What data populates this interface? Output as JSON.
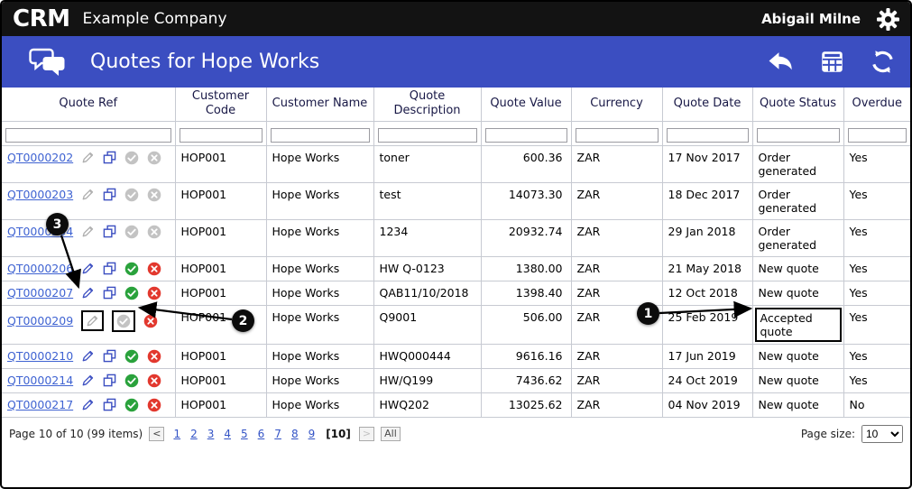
{
  "topbar": {
    "logo_text": "CRM",
    "company": "Example Company",
    "user": "Abigail Milne"
  },
  "header": {
    "title": "Quotes for Hope Works"
  },
  "colors": {
    "brand_blue": "#3b4ec1",
    "link_blue": "#3f63d2",
    "accept_green": "#2aa23c",
    "reject_red": "#e2382e",
    "disabled_grey": "#aeaeae",
    "disabled_circle_grey": "#c3c3c3"
  },
  "table": {
    "columns": [
      "Quote Ref",
      "Customer Code",
      "Customer Name",
      "Quote Description",
      "Quote Value",
      "Currency",
      "Quote Date",
      "Quote Status",
      "Overdue"
    ],
    "rows": [
      {
        "ref": "QT0000202",
        "icons": [
          "edit-disabled",
          "copy",
          "accept-disabled",
          "reject-disabled"
        ],
        "code": "HOP001",
        "name": "Hope Works",
        "desc": "toner",
        "value": "600.36",
        "currency": "ZAR",
        "date": "17 Nov 2017",
        "status": "Order generated",
        "overdue": "Yes",
        "status_boxed": false
      },
      {
        "ref": "QT0000203",
        "icons": [
          "edit-disabled",
          "copy",
          "accept-disabled",
          "reject-disabled"
        ],
        "code": "HOP001",
        "name": "Hope Works",
        "desc": "test",
        "value": "14073.30",
        "currency": "ZAR",
        "date": "18 Dec 2017",
        "status": "Order generated",
        "overdue": "Yes",
        "status_boxed": false
      },
      {
        "ref": "QT0000204",
        "icons": [
          "edit-disabled",
          "copy",
          "accept-disabled",
          "reject-disabled"
        ],
        "code": "HOP001",
        "name": "Hope Works",
        "desc": "1234",
        "value": "20932.74",
        "currency": "ZAR",
        "date": "29 Jan 2018",
        "status": "Order generated",
        "overdue": "Yes",
        "status_boxed": false
      },
      {
        "ref": "QT0000206",
        "icons": [
          "edit",
          "copy",
          "accept",
          "reject"
        ],
        "code": "HOP001",
        "name": "Hope Works",
        "desc": "HW Q-0123",
        "value": "1380.00",
        "currency": "ZAR",
        "date": "21 May 2018",
        "status": "New quote",
        "overdue": "Yes",
        "status_boxed": false
      },
      {
        "ref": "QT0000207",
        "icons": [
          "edit",
          "copy",
          "accept",
          "reject"
        ],
        "code": "HOP001",
        "name": "Hope Works",
        "desc": "QAB11/10/2018",
        "value": "1398.40",
        "currency": "ZAR",
        "date": "12 Oct 2018",
        "status": "New quote",
        "overdue": "Yes",
        "status_boxed": false
      },
      {
        "ref": "QT0000209",
        "icons": [
          "edit-disabled-boxed",
          "accept-disabled-boxed",
          "reject"
        ],
        "code": "HOP001",
        "name": "Hope Works",
        "desc": "Q9001",
        "value": "506.00",
        "currency": "ZAR",
        "date": "25 Feb 2019",
        "status": "Accepted quote",
        "overdue": "Yes",
        "status_boxed": true
      },
      {
        "ref": "QT0000210",
        "icons": [
          "edit",
          "copy",
          "accept",
          "reject"
        ],
        "code": "HOP001",
        "name": "Hope Works",
        "desc": "HWQ000444",
        "value": "9616.16",
        "currency": "ZAR",
        "date": "17 Jun 2019",
        "status": "New quote",
        "overdue": "Yes",
        "status_boxed": false
      },
      {
        "ref": "QT0000214",
        "icons": [
          "edit",
          "copy",
          "accept",
          "reject"
        ],
        "code": "HOP001",
        "name": "Hope Works",
        "desc": "HW/Q199",
        "value": "7436.62",
        "currency": "ZAR",
        "date": "24 Oct 2019",
        "status": "New quote",
        "overdue": "Yes",
        "status_boxed": false
      },
      {
        "ref": "QT0000217",
        "icons": [
          "edit",
          "copy",
          "accept",
          "reject"
        ],
        "code": "HOP001",
        "name": "Hope Works",
        "desc": "HWQ202",
        "value": "13025.62",
        "currency": "ZAR",
        "date": "04 Nov 2019",
        "status": "New quote",
        "overdue": "No",
        "status_boxed": false
      }
    ]
  },
  "pagination": {
    "summary": "Page 10 of 10 (99 items)",
    "prev_label": "<",
    "pages": [
      "1",
      "2",
      "3",
      "4",
      "5",
      "6",
      "7",
      "8",
      "9"
    ],
    "current_label": "[10]",
    "next_label": ">",
    "all_label": "All",
    "page_size_label": "Page size:",
    "page_size": "10"
  },
  "callouts": [
    {
      "number": "1"
    },
    {
      "number": "2"
    },
    {
      "number": "3"
    }
  ]
}
